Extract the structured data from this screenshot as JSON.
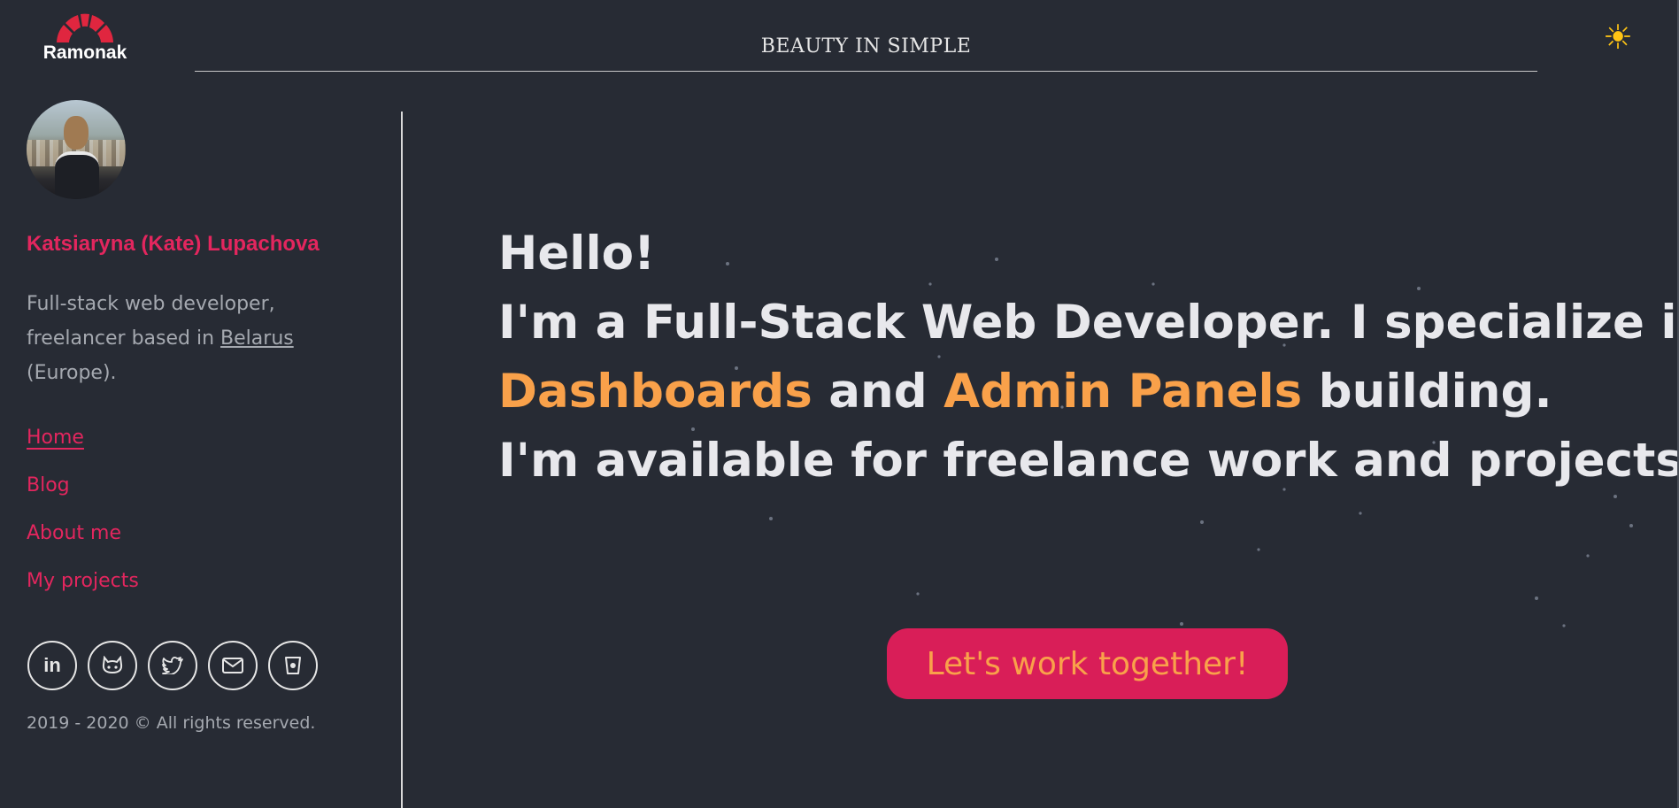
{
  "header": {
    "logo_text": "Ramonak",
    "tagline": "BEAUTY IN SIMPLE",
    "theme_toggle_icon": "sun-icon"
  },
  "sidebar": {
    "name": "Katsiaryna (Kate) Lupachova",
    "bio_prefix": "Full-stack web developer, freelancer based in ",
    "bio_link": "Belarus",
    "bio_suffix": " (Europe).",
    "nav": [
      {
        "label": "Home",
        "active": true
      },
      {
        "label": "Blog",
        "active": false
      },
      {
        "label": "About me",
        "active": false
      },
      {
        "label": "My projects",
        "active": false
      }
    ],
    "socials": [
      {
        "icon": "linkedin-icon",
        "glyph": "in"
      },
      {
        "icon": "github-icon",
        "glyph": ""
      },
      {
        "icon": "twitter-icon",
        "glyph": ""
      },
      {
        "icon": "email-icon",
        "glyph": ""
      },
      {
        "icon": "bucket-icon",
        "glyph": ""
      }
    ],
    "copyright": "2019 - 2020 © All rights reserved."
  },
  "hero": {
    "greeting": "Hello!",
    "line2": "I'm a Full-Stack Web Developer. I specialize in",
    "accent1": "Dashboards",
    "and": " and ",
    "accent2": "Admin Panels",
    "line3_suffix": " building.",
    "line4": "I'm available for freelance work and projects."
  },
  "cta": {
    "label": "Let's work together!"
  },
  "colors": {
    "background": "#272b34",
    "pink": "#e3265e",
    "orange": "#f9a14a",
    "cta_bg": "#d91e58",
    "text": "#e8e8ec",
    "muted": "#a5a9b0"
  }
}
